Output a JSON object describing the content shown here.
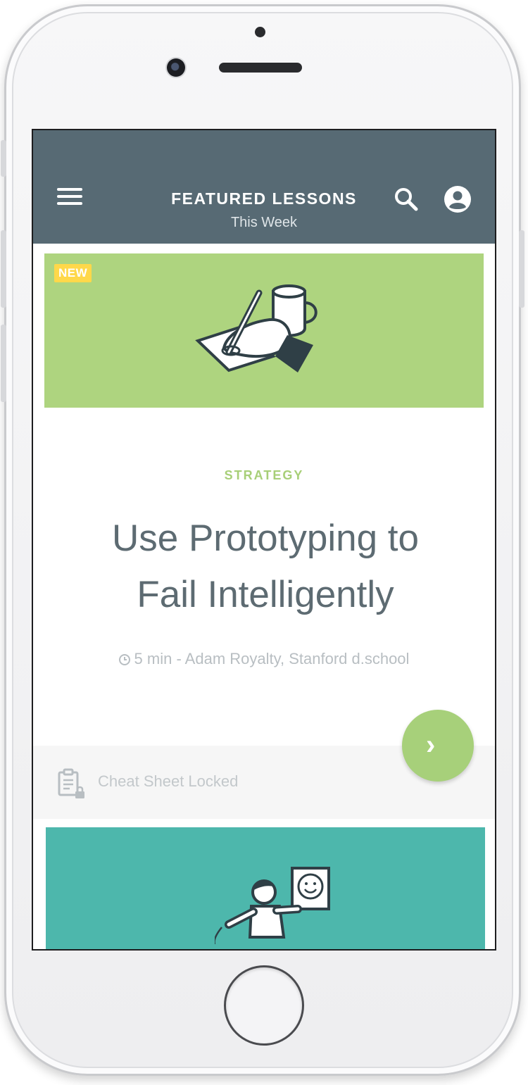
{
  "header": {
    "title": "FEATURED LESSONS",
    "subtitle": "This Week",
    "menu_icon": "hamburger-menu-icon",
    "search_icon": "search-icon",
    "account_icon": "account-circle-icon"
  },
  "lesson": {
    "badge": "NEW",
    "category": "STRATEGY",
    "title_line1": "Use Prototyping to",
    "title_line2": "Fail Intelligently",
    "meta": "5 min - Adam Royalty, Stanford d.school",
    "cheat_sheet": "Cheat Sheet Locked"
  },
  "colors": {
    "header_bg": "#576a74",
    "card1_bg": "#aed47f",
    "card2_bg": "#4db7ac",
    "accent_green": "#a7d07a",
    "badge_yellow": "#ffd84a"
  }
}
